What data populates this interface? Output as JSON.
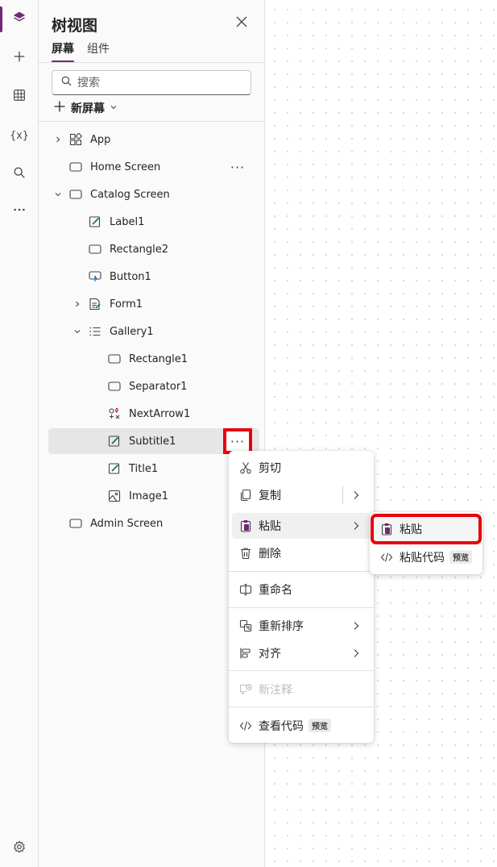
{
  "rail": {
    "items": [
      {
        "name": "tree-view",
        "icon": "layers-icon",
        "active": true
      },
      {
        "name": "insert",
        "icon": "plus-icon"
      },
      {
        "name": "data",
        "icon": "table-icon"
      },
      {
        "name": "variables",
        "icon": "variables-icon",
        "glyph": "{x}"
      },
      {
        "name": "search",
        "icon": "search-icon"
      },
      {
        "name": "more",
        "icon": "more-icon"
      }
    ],
    "settings_icon": "gear-icon"
  },
  "panel": {
    "title": "树视图",
    "tabs": [
      {
        "label": "屏幕",
        "active": true
      },
      {
        "label": "组件",
        "active": false
      }
    ],
    "search_placeholder": "搜索",
    "new_screen_label": "新屏幕"
  },
  "tree": {
    "items": [
      {
        "label": "App",
        "icon": "app-icon",
        "level": 0,
        "chevron": "right"
      },
      {
        "label": "Home Screen",
        "icon": "screen-icon",
        "level": 0,
        "more": true
      },
      {
        "label": "Catalog Screen",
        "icon": "screen-icon",
        "level": 0,
        "chevron": "down"
      },
      {
        "label": "Label1",
        "icon": "label-edit-icon",
        "level": 1
      },
      {
        "label": "Rectangle2",
        "icon": "rectangle-icon",
        "level": 1
      },
      {
        "label": "Button1",
        "icon": "button-icon",
        "level": 1
      },
      {
        "label": "Form1",
        "icon": "form-icon",
        "level": 1,
        "chevron": "right"
      },
      {
        "label": "Gallery1",
        "icon": "gallery-icon",
        "level": 1,
        "chevron": "down"
      },
      {
        "label": "Rectangle1",
        "icon": "rectangle-icon",
        "level": 2
      },
      {
        "label": "Separator1",
        "icon": "rectangle-icon",
        "level": 2
      },
      {
        "label": "NextArrow1",
        "icon": "icon-control-icon",
        "level": 2
      },
      {
        "label": "Subtitle1",
        "icon": "label-edit-icon",
        "level": 2,
        "selected": true,
        "more": true
      },
      {
        "label": "Title1",
        "icon": "label-edit-icon",
        "level": 2
      },
      {
        "label": "Image1",
        "icon": "image-icon",
        "level": 2
      },
      {
        "label": "Admin Screen",
        "icon": "screen-icon",
        "level": 0
      }
    ]
  },
  "context_menu": {
    "cut": "剪切",
    "copy": "复制",
    "paste": "粘贴",
    "delete": "删除",
    "rename": "重命名",
    "reorder": "重新排序",
    "align": "对齐",
    "new_comment": "新注释",
    "view_code": "查看代码",
    "preview_badge": "预览"
  },
  "paste_submenu": {
    "paste": "粘贴",
    "paste_code": "粘贴代码",
    "preview_badge": "预览"
  },
  "colors": {
    "accent": "#742774",
    "highlight_box": "#e8000b",
    "selected_row": "#e6e6e6"
  }
}
